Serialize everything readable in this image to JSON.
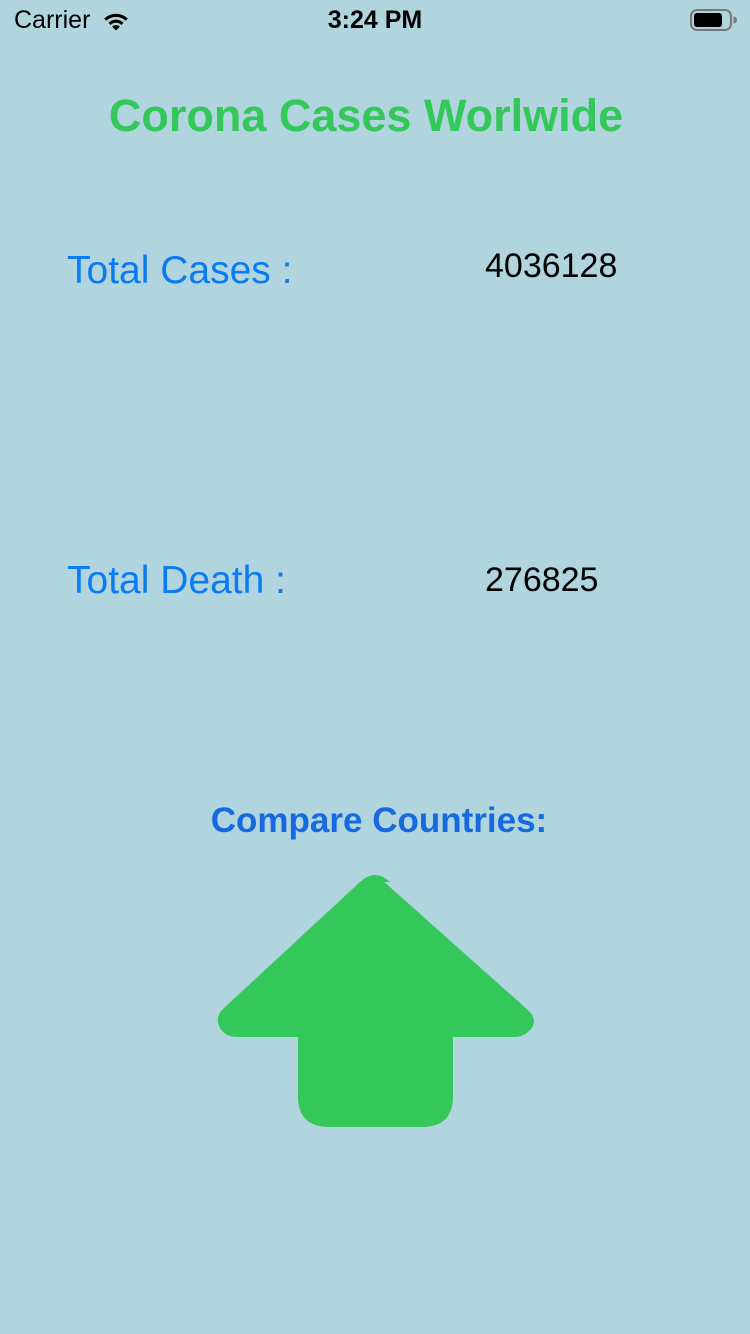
{
  "status_bar": {
    "carrier": "Carrier",
    "time": "3:24 PM",
    "icons": [
      "wifi-icon",
      "battery-icon"
    ]
  },
  "title": "Corona Cases Worlwide",
  "stats": {
    "total_cases_label": "Total Cases :",
    "total_cases_value": "4036128",
    "total_death_label": "Total Death :",
    "total_death_value": "276825"
  },
  "compare": {
    "label": "Compare Countries:",
    "button_icon": "up-arrow-icon"
  },
  "colors": {
    "background": "#b0d5de",
    "title": "#34c759",
    "stat_label": "#0a7bf2",
    "compare_label": "#1769e0",
    "arrow": "#34c759"
  }
}
